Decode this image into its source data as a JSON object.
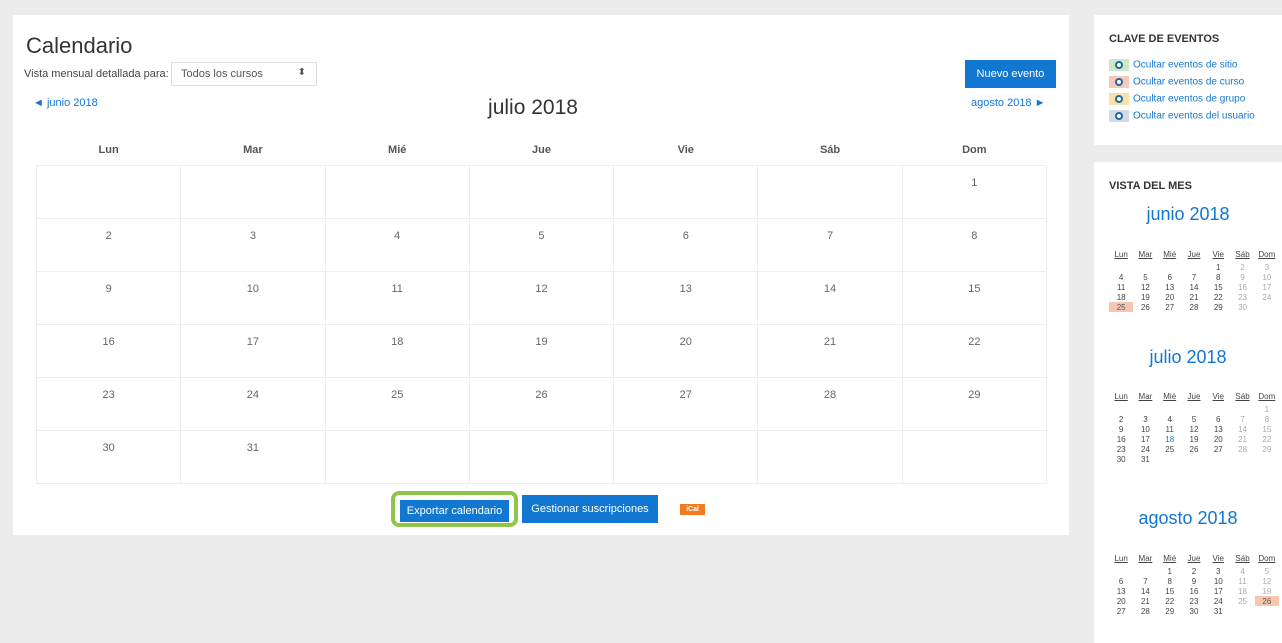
{
  "calendar": {
    "title": "Calendario",
    "view_label": "Vista mensual detallada para:",
    "course_select": "Todos los cursos",
    "new_event": "Nuevo evento",
    "prev_month": "◄ junio 2018",
    "next_month": "agosto 2018 ►",
    "month_title": "julio 2018",
    "weekdays": [
      "Lun",
      "Mar",
      "Mié",
      "Jue",
      "Vie",
      "Sáb",
      "Dom"
    ],
    "weeks": [
      [
        "",
        "",
        "",
        "",
        "",
        "",
        "1"
      ],
      [
        "2",
        "3",
        "4",
        "5",
        "6",
        "7",
        "8"
      ],
      [
        "9",
        "10",
        "11",
        "12",
        "13",
        "14",
        "15"
      ],
      [
        "16",
        "17",
        "18",
        "19",
        "20",
        "21",
        "22"
      ],
      [
        "23",
        "24",
        "25",
        "26",
        "27",
        "28",
        "29"
      ],
      [
        "30",
        "31",
        "",
        "",
        "",
        "",
        ""
      ]
    ],
    "export_button": "Exportar calendario",
    "manage_button": "Gestionar suscripciones",
    "ical_label": "iCal"
  },
  "event_key": {
    "title": "CLAVE DE EVENTOS",
    "items": [
      {
        "label": "Ocultar eventos de sitio",
        "color": "#cfe8c4",
        "icon": "eye-icon"
      },
      {
        "label": "Ocultar eventos de curso",
        "color": "#f6c9b8",
        "icon": "eye-icon"
      },
      {
        "label": "Ocultar eventos de grupo",
        "color": "#fbe0a8",
        "icon": "eye-icon"
      },
      {
        "label": "Ocultar eventos del usuario",
        "color": "#d3dbe6",
        "icon": "eye-icon"
      }
    ]
  },
  "month_view": {
    "title": "VISTA DEL MES",
    "weekdays": [
      "Lun",
      "Mar",
      "Mié",
      "Jue",
      "Vie",
      "Sáb",
      "Dom"
    ],
    "months": [
      {
        "title": "junio 2018",
        "weeks": [
          [
            "",
            "",
            "",
            "",
            "1",
            "2",
            "3"
          ],
          [
            "4",
            "5",
            "6",
            "7",
            "8",
            "9",
            "10"
          ],
          [
            "11",
            "12",
            "13",
            "14",
            "15",
            "16",
            "17"
          ],
          [
            "18",
            "19",
            "20",
            "21",
            "22",
            "23",
            "24"
          ],
          [
            "25",
            "26",
            "27",
            "28",
            "29",
            "30",
            ""
          ]
        ],
        "highlighted": [
          "25"
        ],
        "today": []
      },
      {
        "title": "julio 2018",
        "weeks": [
          [
            "",
            "",
            "",
            "",
            "",
            "",
            "1"
          ],
          [
            "2",
            "3",
            "4",
            "5",
            "6",
            "7",
            "8"
          ],
          [
            "9",
            "10",
            "11",
            "12",
            "13",
            "14",
            "15"
          ],
          [
            "16",
            "17",
            "18",
            "19",
            "20",
            "21",
            "22"
          ],
          [
            "23",
            "24",
            "25",
            "26",
            "27",
            "28",
            "29"
          ],
          [
            "30",
            "31",
            "",
            "",
            "",
            "",
            ""
          ]
        ],
        "highlighted": [],
        "today": [
          "18"
        ]
      },
      {
        "title": "agosto 2018",
        "weeks": [
          [
            "",
            "",
            "1",
            "2",
            "3",
            "4",
            "5"
          ],
          [
            "6",
            "7",
            "8",
            "9",
            "10",
            "11",
            "12"
          ],
          [
            "13",
            "14",
            "15",
            "16",
            "17",
            "18",
            "19"
          ],
          [
            "20",
            "21",
            "22",
            "23",
            "24",
            "25",
            "26"
          ],
          [
            "27",
            "28",
            "29",
            "30",
            "31",
            "",
            ""
          ]
        ],
        "highlighted": [
          "26"
        ],
        "today": []
      }
    ]
  }
}
